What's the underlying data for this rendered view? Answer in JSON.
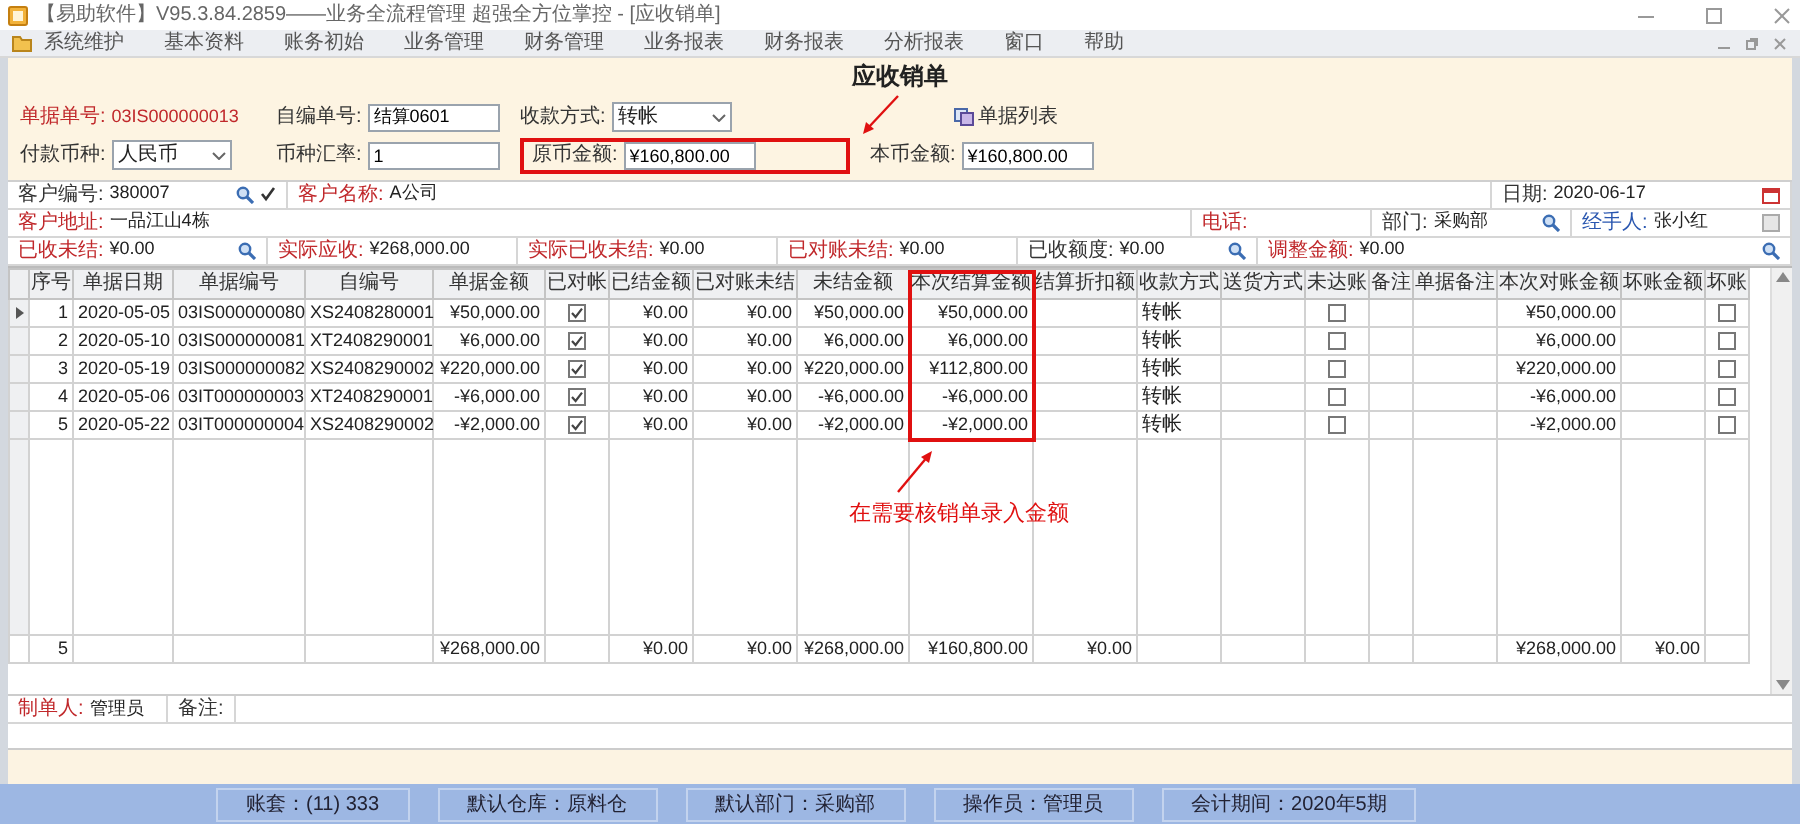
{
  "window": {
    "title": "【易助软件】V95.3.84.2859——业务全流程管理 超强全方位掌控 - [应收销单]"
  },
  "menu": [
    "系统维护",
    "基本资料",
    "账务初始",
    "业务管理",
    "财务管理",
    "业务报表",
    "财务报表",
    "分析报表",
    "窗口",
    "帮助"
  ],
  "form": {
    "title": "应收销单",
    "rows": [
      [
        {
          "label": "单据单号:",
          "value": "03IS000000013",
          "kind": "serial",
          "required": true,
          "highlighted": false
        },
        {
          "label": "自编单号:",
          "value": "结算0601",
          "kind": "text",
          "required": false,
          "highlighted": false
        },
        {
          "label": "收款方式:",
          "value": "转帐",
          "kind": "select",
          "required": false,
          "highlighted": false
        },
        {
          "label": "单据列表",
          "kind": "button"
        }
      ],
      [
        {
          "label": "付款币种:",
          "value": "人民币",
          "kind": "select",
          "required": false,
          "highlighted": false
        },
        {
          "label": "币种汇率:",
          "value": "1",
          "kind": "text",
          "required": false,
          "highlighted": false
        },
        {
          "label": "原币金额:",
          "value": "¥160,800.00",
          "kind": "text",
          "required": false,
          "highlighted": true
        },
        {
          "label": "本币金额:",
          "value": "¥160,800.00",
          "kind": "text",
          "required": false,
          "highlighted": false
        }
      ]
    ]
  },
  "info_rows": [
    [
      {
        "label": "客户编号:",
        "value": "380007",
        "kind": "plain",
        "required": false,
        "lookup": true,
        "verified": true
      },
      {
        "label": "客户名称:",
        "value": "A公司",
        "kind": "plain",
        "required": true
      },
      {
        "label": "日期:",
        "value": "2020-06-17",
        "kind": "date",
        "required": false
      }
    ],
    [
      {
        "label": "客户地址:",
        "value": "一品江山4栋",
        "kind": "plain",
        "required": true
      },
      {
        "label": "电话:",
        "kind": "plain",
        "required": true
      },
      {
        "label": "部门:",
        "value": "采购部",
        "kind": "plain",
        "required": false,
        "lookup": true
      },
      {
        "label": "经手人:",
        "value": "张小红",
        "kind": "picker",
        "required": false
      }
    ],
    [
      {
        "label": "已收未结:",
        "value": "¥0.00",
        "kind": "plain",
        "required": true,
        "lookup": true
      },
      {
        "label": "实际应收:",
        "value": "¥268,000.00",
        "kind": "plain",
        "required": true
      },
      {
        "label": "实际已收未结:",
        "value": "¥0.00",
        "kind": "plain",
        "required": true
      },
      {
        "label": "已对账未结:",
        "value": "¥0.00",
        "kind": "plain",
        "required": true
      },
      {
        "label": "已收额度:",
        "value": "¥0.00",
        "kind": "plain",
        "required": false,
        "lookup": true
      },
      {
        "label": "调整金额:",
        "value": "¥0.00",
        "kind": "plain",
        "required": true,
        "lookup": true
      }
    ]
  ],
  "table": {
    "columns": [
      {
        "label": "序号",
        "total": "5",
        "highlighted": false
      },
      {
        "label": "单据日期",
        "highlighted": false
      },
      {
        "label": "单据编号",
        "highlighted": false
      },
      {
        "label": "自编号",
        "highlighted": false
      },
      {
        "label": "单据金额",
        "total": "¥268,000.00",
        "highlighted": false
      },
      {
        "label": "已对帐",
        "highlighted": false
      },
      {
        "label": "已结金额",
        "total": "¥0.00",
        "highlighted": false
      },
      {
        "label": "已对账未结",
        "total": "¥0.00",
        "highlighted": false
      },
      {
        "label": "未结金额",
        "total": "¥268,000.00",
        "highlighted": false
      },
      {
        "label": "本次结算金额",
        "total": "¥160,800.00",
        "highlighted": true
      },
      {
        "label": "结算折扣额",
        "total": "¥0.00",
        "highlighted": false
      },
      {
        "label": "收款方式",
        "highlighted": false
      },
      {
        "label": "送货方式",
        "highlighted": false
      },
      {
        "label": "未达账",
        "highlighted": false
      },
      {
        "label": "备注",
        "highlighted": false
      },
      {
        "label": "单据备注",
        "highlighted": false
      },
      {
        "label": "本次对账金额",
        "total": "¥268,000.00",
        "highlighted": false
      },
      {
        "label": "坏账金额",
        "total": "¥0.00",
        "highlighted": false
      },
      {
        "label": "坏账",
        "highlighted": false
      }
    ],
    "rows": [
      {
        "selected": true,
        "no": "1",
        "date": "2020-05-05",
        "doc_no": "03IS000000080",
        "own_no": "XS2408280001",
        "amount": "¥50,000.00",
        "reconciled": true,
        "settled": "¥0.00",
        "reconciled_unsettled": "¥0.00",
        "unsettled": "¥50,000.00",
        "settle_now": "¥50,000.00",
        "method": "转帐",
        "unreached": false,
        "reconcile_now": "¥50,000.00",
        "bad_debt": false
      },
      {
        "selected": false,
        "no": "2",
        "date": "2020-05-10",
        "doc_no": "03IS000000081",
        "own_no": "XT2408290001",
        "amount": "¥6,000.00",
        "reconciled": true,
        "settled": "¥0.00",
        "reconciled_unsettled": "¥0.00",
        "unsettled": "¥6,000.00",
        "settle_now": "¥6,000.00",
        "method": "转帐",
        "unreached": false,
        "reconcile_now": "¥6,000.00",
        "bad_debt": false
      },
      {
        "selected": false,
        "no": "3",
        "date": "2020-05-19",
        "doc_no": "03IS000000082",
        "own_no": "XS2408290002",
        "amount": "¥220,000.00",
        "reconciled": true,
        "settled": "¥0.00",
        "reconciled_unsettled": "¥0.00",
        "unsettled": "¥220,000.00",
        "settle_now": "¥112,800.00",
        "method": "转帐",
        "unreached": false,
        "reconcile_now": "¥220,000.00",
        "bad_debt": false
      },
      {
        "selected": false,
        "no": "4",
        "date": "2020-05-06",
        "doc_no": "03IT000000003",
        "own_no": "XT2408290001",
        "amount": "-¥6,000.00",
        "reconciled": true,
        "settled": "¥0.00",
        "reconciled_unsettled": "¥0.00",
        "unsettled": "-¥6,000.00",
        "settle_now": "-¥6,000.00",
        "method": "转帐",
        "unreached": false,
        "reconcile_now": "-¥6,000.00",
        "bad_debt": false
      },
      {
        "selected": false,
        "no": "5",
        "date": "2020-05-22",
        "doc_no": "03IT000000004",
        "own_no": "XS2408290002",
        "amount": "-¥2,000.00",
        "reconciled": true,
        "settled": "¥0.00",
        "reconciled_unsettled": "¥0.00",
        "unsettled": "-¥2,000.00",
        "settle_now": "-¥2,000.00",
        "method": "转帐",
        "unreached": false,
        "reconcile_now": "-¥2,000.00",
        "bad_debt": false
      }
    ]
  },
  "annotation": {
    "text": "在需要核销单录入金额"
  },
  "footer": [
    {
      "label": "制单人:",
      "value": "管理员",
      "required": true
    },
    {
      "label": "备注:",
      "required": false
    }
  ],
  "status_bar": [
    "账套：(11) 333",
    "默认仓库：原料仓",
    "默认部门：采购部",
    "操作员：管理员",
    "会计期间：2020年5期"
  ]
}
